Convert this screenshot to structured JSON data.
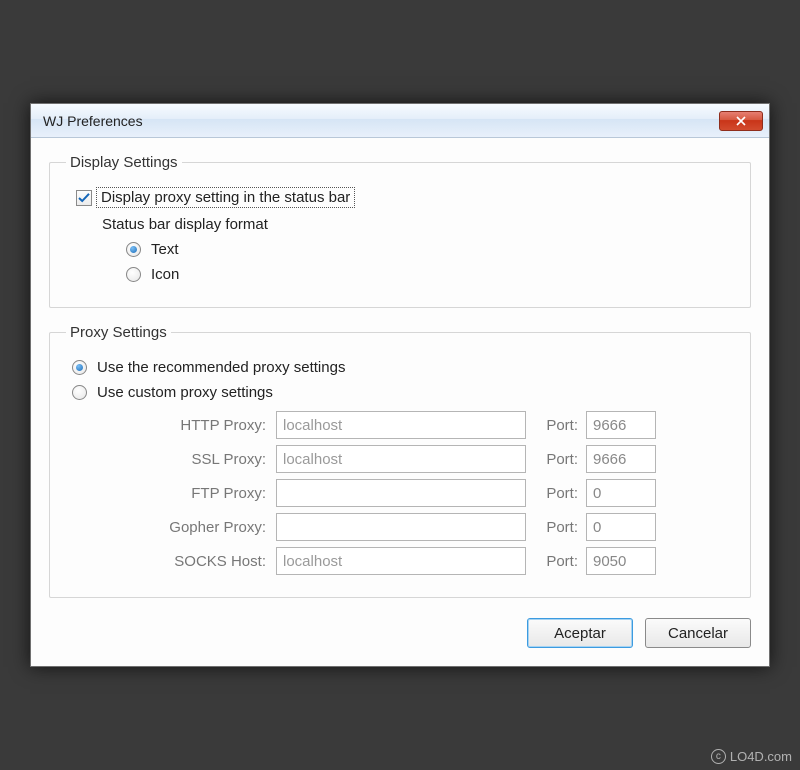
{
  "window": {
    "title": "WJ Preferences"
  },
  "display": {
    "legend": "Display Settings",
    "showInStatusBar": {
      "label": "Display proxy setting in the status bar",
      "checked": true
    },
    "formatLabel": "Status bar display format",
    "format": {
      "text": "Text",
      "icon": "Icon",
      "selected": "text"
    }
  },
  "proxy": {
    "legend": "Proxy Settings",
    "recommendedLabel": "Use the recommended proxy settings",
    "customLabel": "Use custom proxy settings",
    "mode": "recommended",
    "portLabel": "Port:",
    "rows": [
      {
        "label": "HTTP Proxy:",
        "host": "localhost",
        "port": "9666"
      },
      {
        "label": "SSL Proxy:",
        "host": "localhost",
        "port": "9666"
      },
      {
        "label": "FTP Proxy:",
        "host": "",
        "port": "0"
      },
      {
        "label": "Gopher Proxy:",
        "host": "",
        "port": "0"
      },
      {
        "label": "SOCKS Host:",
        "host": "localhost",
        "port": "9050"
      }
    ]
  },
  "buttons": {
    "ok": "Aceptar",
    "cancel": "Cancelar"
  },
  "watermark": "LO4D.com"
}
